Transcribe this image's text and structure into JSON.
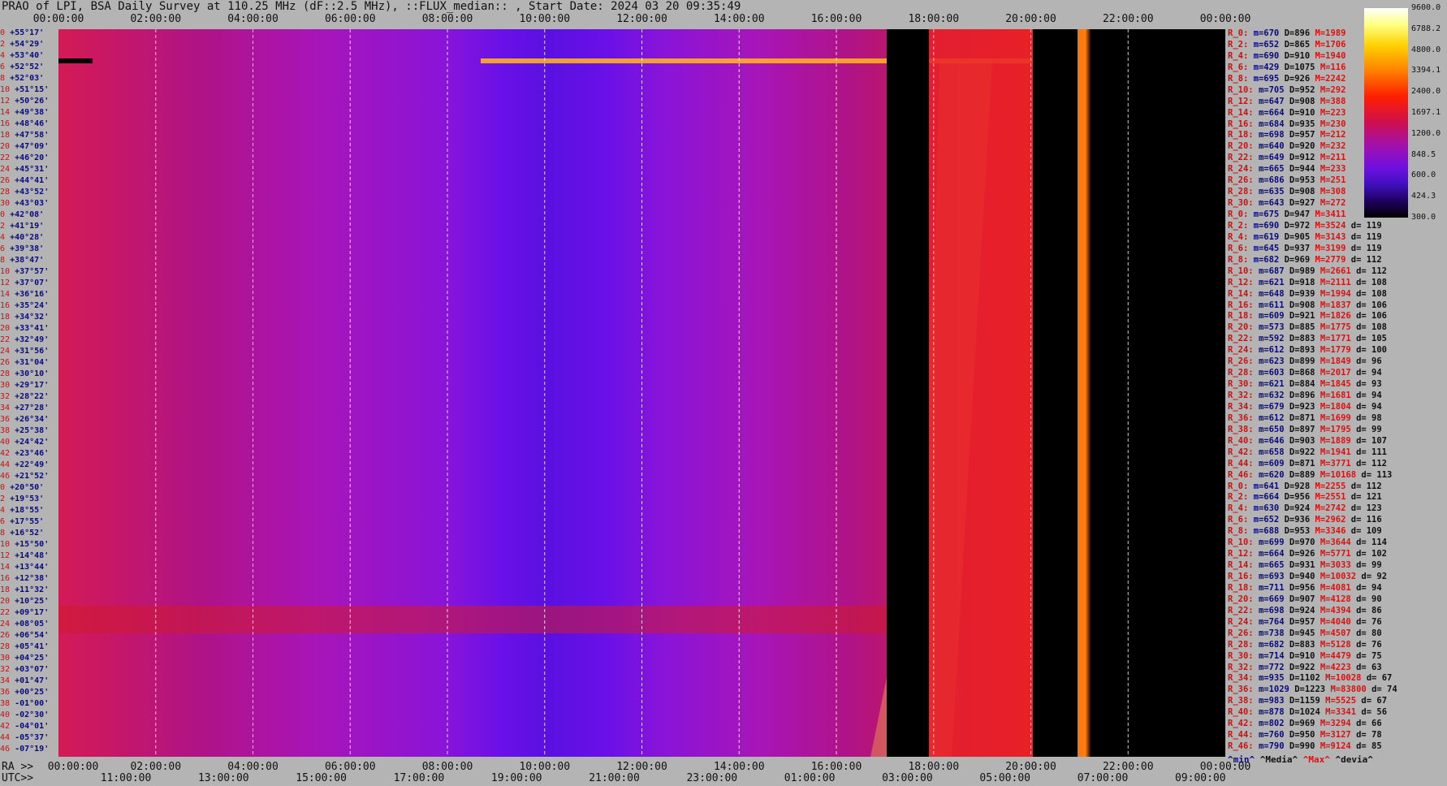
{
  "title": "PRAO of LPI, BSA Daily Survey at 110.25 MHz (dF::2.5 MHz), ::FLUX_median:: , Start Date: 2024 03 20 09:35:49",
  "chart_data": {
    "type": "heatmap",
    "top_axis_labels": [
      "00:00:00",
      "02:00:00",
      "04:00:00",
      "06:00:00",
      "08:00:00",
      "10:00:00",
      "12:00:00",
      "14:00:00",
      "16:00:00",
      "18:00:00",
      "20:00:00",
      "22:00:00",
      "00:00:00"
    ],
    "ra_label": "RA >>",
    "ra_axis_labels": [
      "00:00:00",
      "02:00:00",
      "04:00:00",
      "06:00:00",
      "08:00:00",
      "10:00:00",
      "12:00:00",
      "14:00:00",
      "16:00:00",
      "18:00:00",
      "20:00:00",
      "22:00:00",
      "00:00:00"
    ],
    "utc_label": "UTC>>",
    "utc_axis_labels": [
      "11:00:00",
      "13:00:00",
      "15:00:00",
      "17:00:00",
      "19:00:00",
      "21:00:00",
      "23:00:00",
      "01:00:00",
      "03:00:00",
      "05:00:00",
      "07:00:00",
      "09:00:00"
    ],
    "dec_labels": [
      [
        "0",
        "+55°17'"
      ],
      [
        "2",
        "+54°29'"
      ],
      [
        "4",
        "+53°40'"
      ],
      [
        "6",
        "+52°52'"
      ],
      [
        "8",
        "+52°03'"
      ],
      [
        "10",
        "+51°15'"
      ],
      [
        "12",
        "+50°26'"
      ],
      [
        "14",
        "+49°38'"
      ],
      [
        "16",
        "+48°46'"
      ],
      [
        "18",
        "+47°58'"
      ],
      [
        "20",
        "+47°09'"
      ],
      [
        "22",
        "+46°20'"
      ],
      [
        "24",
        "+45°31'"
      ],
      [
        "26",
        "+44°41'"
      ],
      [
        "28",
        "+43°52'"
      ],
      [
        "30",
        "+43°03'"
      ],
      [
        "0",
        "+42°08'"
      ],
      [
        "2",
        "+41°19'"
      ],
      [
        "4",
        "+40°28'"
      ],
      [
        "6",
        "+39°38'"
      ],
      [
        "8",
        "+38°47'"
      ],
      [
        "10",
        "+37°57'"
      ],
      [
        "12",
        "+37°07'"
      ],
      [
        "14",
        "+36°16'"
      ],
      [
        "16",
        "+35°24'"
      ],
      [
        "18",
        "+34°32'"
      ],
      [
        "20",
        "+33°41'"
      ],
      [
        "22",
        "+32°49'"
      ],
      [
        "24",
        "+31°56'"
      ],
      [
        "26",
        "+31°04'"
      ],
      [
        "28",
        "+30°10'"
      ],
      [
        "30",
        "+29°17'"
      ],
      [
        "32",
        "+28°22'"
      ],
      [
        "34",
        "+27°28'"
      ],
      [
        "36",
        "+26°34'"
      ],
      [
        "38",
        "+25°38'"
      ],
      [
        "40",
        "+24°42'"
      ],
      [
        "42",
        "+23°46'"
      ],
      [
        "44",
        "+22°49'"
      ],
      [
        "46",
        "+21°52'"
      ],
      [
        "0",
        "+20°50'"
      ],
      [
        "2",
        "+19°53'"
      ],
      [
        "4",
        "+18°55'"
      ],
      [
        "6",
        "+17°55'"
      ],
      [
        "8",
        "+16°52'"
      ],
      [
        "10",
        "+15°50'"
      ],
      [
        "12",
        "+14°48'"
      ],
      [
        "14",
        "+13°44'"
      ],
      [
        "16",
        "+12°38'"
      ],
      [
        "18",
        "+11°32'"
      ],
      [
        "20",
        "+10°25'"
      ],
      [
        "22",
        "+09°17'"
      ],
      [
        "24",
        "+08°05'"
      ],
      [
        "26",
        "+06°54'"
      ],
      [
        "28",
        "+05°41'"
      ],
      [
        "30",
        "+04°25'"
      ],
      [
        "32",
        "+03°07'"
      ],
      [
        "34",
        "+01°47'"
      ],
      [
        "36",
        "+00°25'"
      ],
      [
        "38",
        "-01°00'"
      ],
      [
        "40",
        "-02°30'"
      ],
      [
        "42",
        "-04°01'"
      ],
      [
        "44",
        "-05°37'"
      ],
      [
        "46",
        "-07°19'"
      ]
    ],
    "colorbar_labels": [
      "9600.0",
      "6788.2",
      "4800.0",
      "3394.1",
      "2400.0",
      "1697.1",
      "1200.0",
      "848.5",
      "600.0",
      "424.3",
      "300.0"
    ],
    "colorbar_range": [
      300,
      9600
    ],
    "colorbar_scale": "log",
    "stats_legend": [
      "^min^",
      "^Media^",
      "^Max^",
      "^devia^"
    ],
    "stats": [
      [
        "R_0:",
        "m=670",
        "D=896",
        "M=1989",
        ""
      ],
      [
        "R_2:",
        "m=652",
        "D=865",
        "M=1706",
        ""
      ],
      [
        "R_4:",
        "m=690",
        "D=910",
        "M=1940",
        ""
      ],
      [
        "R_6:",
        "m=429",
        "D=1075",
        "M=116",
        ""
      ],
      [
        "R_8:",
        "m=695",
        "D=926",
        "M=2242",
        ""
      ],
      [
        "R_10:",
        "m=705",
        "D=952",
        "M=292",
        ""
      ],
      [
        "R_12:",
        "m=647",
        "D=908",
        "M=388",
        ""
      ],
      [
        "R_14:",
        "m=664",
        "D=910",
        "M=223",
        ""
      ],
      [
        "R_16:",
        "m=684",
        "D=935",
        "M=230",
        ""
      ],
      [
        "R_18:",
        "m=698",
        "D=957",
        "M=212",
        ""
      ],
      [
        "R_20:",
        "m=640",
        "D=920",
        "M=232",
        ""
      ],
      [
        "R_22:",
        "m=649",
        "D=912",
        "M=211",
        ""
      ],
      [
        "R_24:",
        "m=665",
        "D=944",
        "M=233",
        ""
      ],
      [
        "R_26:",
        "m=686",
        "D=953",
        "M=251",
        ""
      ],
      [
        "R_28:",
        "m=635",
        "D=908",
        "M=308",
        ""
      ],
      [
        "R_30:",
        "m=643",
        "D=927",
        "M=272",
        ""
      ],
      [
        "R_0:",
        "m=675",
        "D=947",
        "M=3411",
        ""
      ],
      [
        "R_2:",
        "m=690",
        "D=972",
        "M=3524",
        "d= 119"
      ],
      [
        "R_4:",
        "m=619",
        "D=905",
        "M=3143",
        "d= 119"
      ],
      [
        "R_6:",
        "m=645",
        "D=937",
        "M=3199",
        "d= 119"
      ],
      [
        "R_8:",
        "m=682",
        "D=969",
        "M=2779",
        "d= 112"
      ],
      [
        "R_10:",
        "m=687",
        "D=989",
        "M=2661",
        "d= 112"
      ],
      [
        "R_12:",
        "m=621",
        "D=918",
        "M=2111",
        "d= 108"
      ],
      [
        "R_14:",
        "m=648",
        "D=939",
        "M=1994",
        "d= 108"
      ],
      [
        "R_16:",
        "m=611",
        "D=908",
        "M=1837",
        "d= 106"
      ],
      [
        "R_18:",
        "m=609",
        "D=921",
        "M=1826",
        "d= 106"
      ],
      [
        "R_20:",
        "m=573",
        "D=885",
        "M=1775",
        "d= 108"
      ],
      [
        "R_22:",
        "m=592",
        "D=883",
        "M=1771",
        "d= 105"
      ],
      [
        "R_24:",
        "m=612",
        "D=893",
        "M=1779",
        "d= 100"
      ],
      [
        "R_26:",
        "m=623",
        "D=899",
        "M=1849",
        "d= 96"
      ],
      [
        "R_28:",
        "m=603",
        "D=868",
        "M=2017",
        "d= 94"
      ],
      [
        "R_30:",
        "m=621",
        "D=884",
        "M=1845",
        "d= 93"
      ],
      [
        "R_32:",
        "m=632",
        "D=896",
        "M=1681",
        "d= 94"
      ],
      [
        "R_34:",
        "m=679",
        "D=923",
        "M=1804",
        "d= 94"
      ],
      [
        "R_36:",
        "m=612",
        "D=871",
        "M=1699",
        "d= 98"
      ],
      [
        "R_38:",
        "m=650",
        "D=897",
        "M=1795",
        "d= 99"
      ],
      [
        "R_40:",
        "m=646",
        "D=903",
        "M=1889",
        "d= 107"
      ],
      [
        "R_42:",
        "m=658",
        "D=922",
        "M=1941",
        "d= 111"
      ],
      [
        "R_44:",
        "m=609",
        "D=871",
        "M=3771",
        "d= 112"
      ],
      [
        "R_46:",
        "m=620",
        "D=889",
        "M=10168",
        "d= 113"
      ],
      [
        "R_0:",
        "m=641",
        "D=928",
        "M=2255",
        "d= 112"
      ],
      [
        "R_2:",
        "m=664",
        "D=956",
        "M=2551",
        "d= 121"
      ],
      [
        "R_4:",
        "m=630",
        "D=924",
        "M=2742",
        "d= 123"
      ],
      [
        "R_6:",
        "m=652",
        "D=936",
        "M=2962",
        "d= 116"
      ],
      [
        "R_8:",
        "m=688",
        "D=953",
        "M=3346",
        "d= 109"
      ],
      [
        "R_10:",
        "m=699",
        "D=970",
        "M=3644",
        "d= 114"
      ],
      [
        "R_12:",
        "m=664",
        "D=926",
        "M=5771",
        "d= 102"
      ],
      [
        "R_14:",
        "m=665",
        "D=931",
        "M=3033",
        "d= 99"
      ],
      [
        "R_16:",
        "m=693",
        "D=940",
        "M=10032",
        "d= 92"
      ],
      [
        "R_18:",
        "m=711",
        "D=956",
        "M=4081",
        "d= 94"
      ],
      [
        "R_20:",
        "m=669",
        "D=907",
        "M=4128",
        "d= 90"
      ],
      [
        "R_22:",
        "m=698",
        "D=924",
        "M=4394",
        "d= 86"
      ],
      [
        "R_24:",
        "m=764",
        "D=957",
        "M=4040",
        "d= 76"
      ],
      [
        "R_26:",
        "m=738",
        "D=945",
        "M=4507",
        "d= 80"
      ],
      [
        "R_28:",
        "m=682",
        "D=883",
        "M=5128",
        "d= 76"
      ],
      [
        "R_30:",
        "m=714",
        "D=910",
        "M=4479",
        "d= 75"
      ],
      [
        "R_32:",
        "m=772",
        "D=922",
        "M=4223",
        "d= 63"
      ],
      [
        "R_34:",
        "m=935",
        "D=1102",
        "M=10028",
        "d= 67"
      ],
      [
        "R_36:",
        "m=1029",
        "D=1223",
        "M=83800",
        "d= 74"
      ],
      [
        "R_38:",
        "m=983",
        "D=1159",
        "M=5525",
        "d= 67"
      ],
      [
        "R_40:",
        "m=878",
        "D=1024",
        "M=3341",
        "d= 56"
      ],
      [
        "R_42:",
        "m=802",
        "D=969",
        "M=3294",
        "d= 66"
      ],
      [
        "R_44:",
        "m=760",
        "D=950",
        "M=3127",
        "d= 78"
      ],
      [
        "R_46:",
        "m=790",
        "D=990",
        "M=9124",
        "d= 85"
      ]
    ]
  }
}
